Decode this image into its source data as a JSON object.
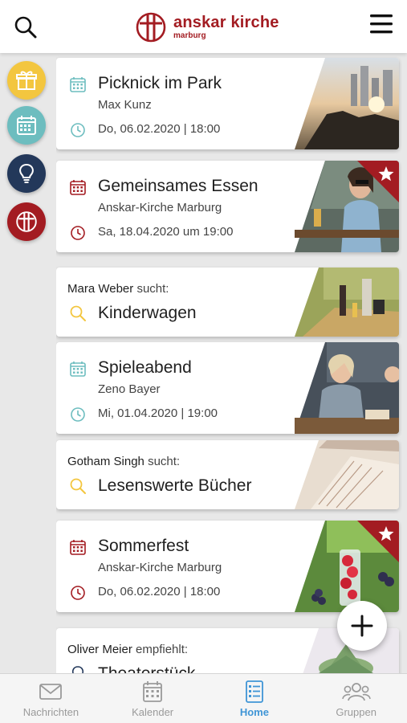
{
  "header": {
    "brand": "anskar kirche",
    "city": "marburg"
  },
  "feed": [
    {
      "kind": "event",
      "title": "Picknick im Park",
      "organizer": "Max Kunz",
      "date": "Do, 06.02.2020 | 18:00",
      "icon_color": "#6dbdbf",
      "starred": false
    },
    {
      "kind": "event",
      "title": "Gemeinsames Essen",
      "organizer": "Anskar-Kirche Marburg",
      "date": "Sa, 18.04.2020 um 19:00",
      "icon_color": "#a31c22",
      "starred": true
    },
    {
      "kind": "search",
      "person": "Mara Weber",
      "verb": "sucht:",
      "title": "Kinderwagen"
    },
    {
      "kind": "event",
      "title": "Spieleabend",
      "organizer": "Zeno Bayer",
      "date": "Mi, 01.04.2020 | 19:00",
      "icon_color": "#6dbdbf",
      "starred": false
    },
    {
      "kind": "search",
      "person": "Gotham Singh",
      "verb": "sucht:",
      "title": "Lesenswerte Bücher"
    },
    {
      "kind": "event",
      "title": "Sommerfest",
      "organizer": "Anskar-Kirche Marburg",
      "date": "Do, 06.02.2020 | 18:00",
      "icon_color": "#a31c22",
      "starred": true
    },
    {
      "kind": "recommend",
      "person": "Oliver Meier",
      "verb": "empfiehlt:",
      "title": "Theaterstück"
    }
  ],
  "nav": {
    "messages": "Nachrichten",
    "calendar": "Kalender",
    "home": "Home",
    "groups": "Gruppen",
    "active": "home"
  },
  "colors": {
    "brand_red": "#a31c22",
    "teal": "#6dbdbf",
    "yellow": "#f3c63f",
    "navy": "#23385a",
    "active_blue": "#3f95d6"
  }
}
